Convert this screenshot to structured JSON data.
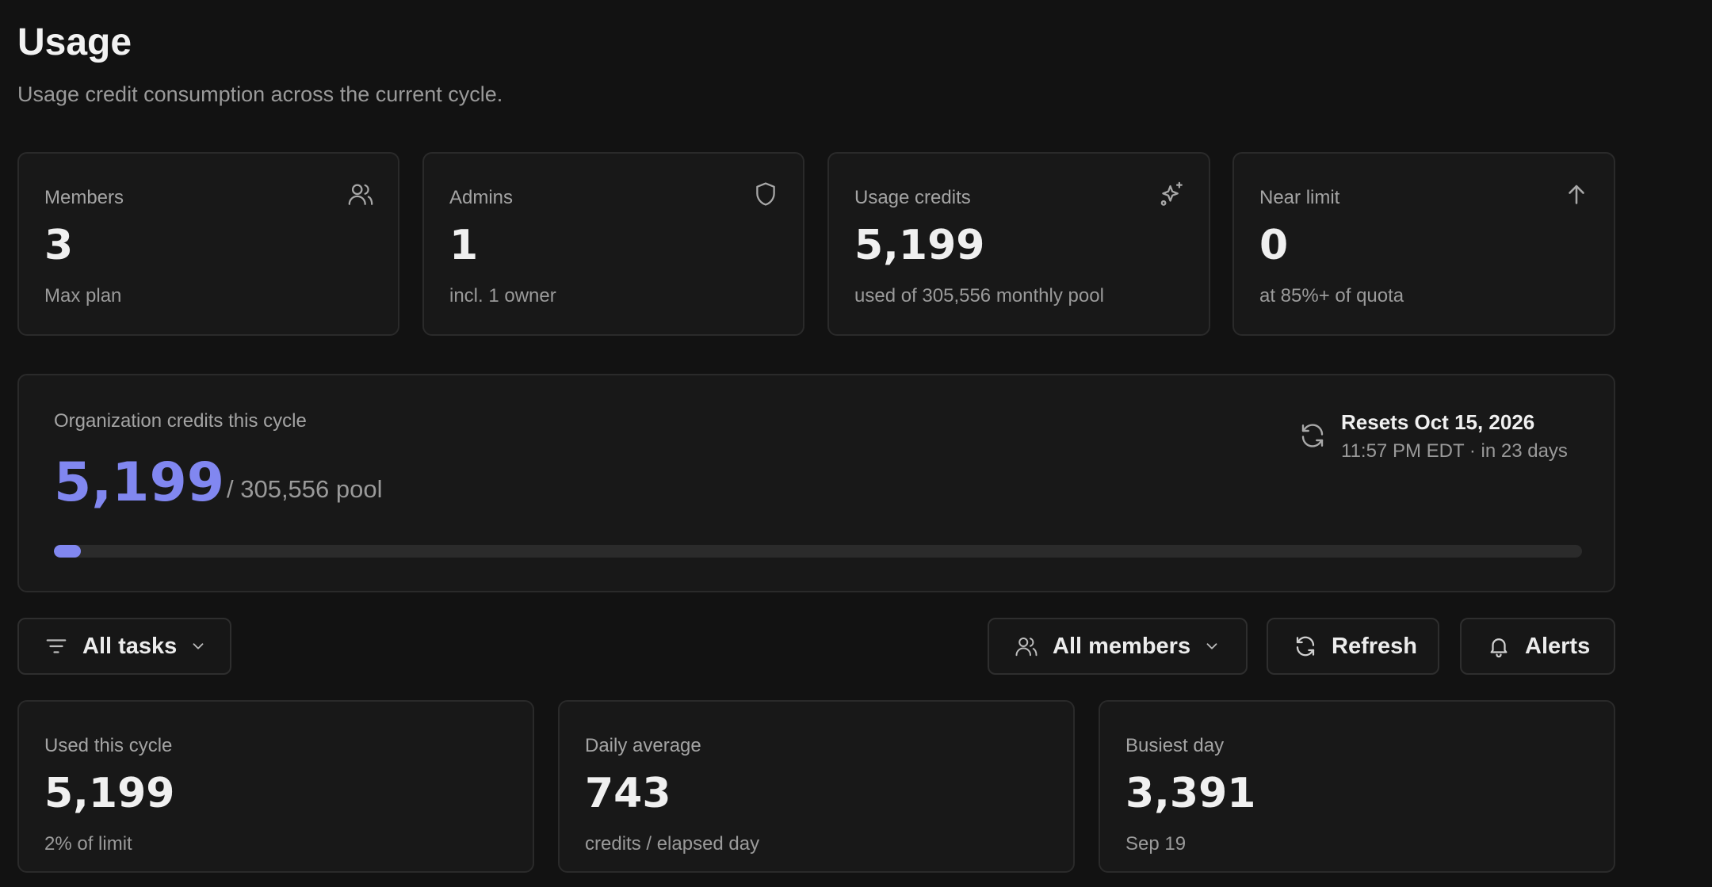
{
  "page": {
    "title": "Usage",
    "subtitle": "Usage credit consumption across the current cycle."
  },
  "stats": [
    {
      "label": "Members",
      "value": "3",
      "sub": "Max plan",
      "icon": "users-icon"
    },
    {
      "label": "Admins",
      "value": "1",
      "sub": "incl. 1 owner",
      "icon": "shield-icon"
    },
    {
      "label": "Usage credits",
      "value": "5,199",
      "sub": "used of 305,556 monthly pool",
      "icon": "sparkles-icon"
    },
    {
      "label": "Near limit",
      "value": "0",
      "sub": "at 85%+ of quota",
      "icon": "arrow-up-icon"
    }
  ],
  "org": {
    "label": "Organization credits this cycle",
    "value": "5,199",
    "pool": "/ 305,556 pool",
    "reset_title": "Resets Oct 15, 2026",
    "reset_sub": "11:57 PM EDT · in 23 days",
    "progress_fraction": 0.017
  },
  "toolbar": {
    "tasks_filter": "All tasks",
    "members_filter": "All members",
    "refresh_label": "Refresh",
    "alerts_label": "Alerts"
  },
  "summary": [
    {
      "label": "Used this cycle",
      "value": "5,199",
      "sub": "2% of limit"
    },
    {
      "label": "Daily average",
      "value": "743",
      "sub": "credits / elapsed day"
    },
    {
      "label": "Busiest day",
      "value": "3,391",
      "sub": "Sep 19"
    }
  ],
  "colors": {
    "accent": "#8187f0",
    "background": "#121212",
    "card": "#181818",
    "border": "#2a2a2a"
  }
}
